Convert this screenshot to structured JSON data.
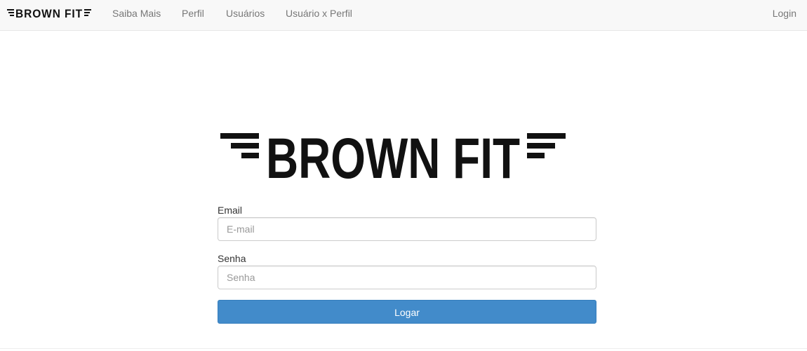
{
  "navbar": {
    "brand": "BROWN FIT",
    "links": [
      "Saiba Mais",
      "Perfil",
      "Usuários",
      "Usuário x Perfil"
    ],
    "login": "Login"
  },
  "logo": {
    "text": "BROWN FIT"
  },
  "form": {
    "email_label": "Email",
    "email_placeholder": "E-mail",
    "password_label": "Senha",
    "password_placeholder": "Senha",
    "submit_label": "Logar"
  },
  "colors": {
    "primary": "#428bca",
    "navbar_bg": "#f8f8f8",
    "nav_text": "#777777"
  }
}
